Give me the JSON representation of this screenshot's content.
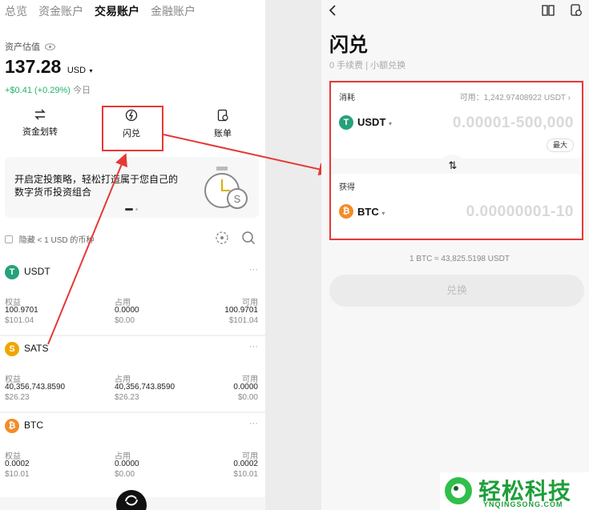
{
  "left": {
    "tabs": [
      "总览",
      "资金账户",
      "交易账户",
      "金融账户"
    ],
    "asset_label": "资产估值",
    "asset_value": "137.28",
    "asset_currency": "USD",
    "change": "+$0.41 (+0.29%)",
    "change_period": "今日",
    "actions": [
      "资金划转",
      "闪兑",
      "账单"
    ],
    "banner_text_1": "开启定投策略，轻松打造属于您自己的",
    "banner_text_2": "数字货币投资组合",
    "hide_small": "隐藏 < 1 USD 的币种",
    "col_labels": [
      "权益",
      "占用",
      "可用"
    ],
    "coins": [
      {
        "name": "USDT",
        "symbol": "T",
        "color": "#26a17b",
        "equity": "100.9701",
        "equity_usd": "$101.04",
        "used": "0.0000",
        "used_usd": "$0.00",
        "avail": "100.9701",
        "avail_usd": "$101.04"
      },
      {
        "name": "SATS",
        "symbol": "S",
        "color": "#f0a500",
        "equity": "40,356,743.8590",
        "equity_usd": "$26.23",
        "used": "40,356,743.8590",
        "used_usd": "$26.23",
        "avail": "0.0000",
        "avail_usd": "$0.00"
      },
      {
        "name": "BTC",
        "symbol": "₿",
        "color": "#f28c28",
        "equity": "0.0002",
        "equity_usd": "$10.01",
        "used": "0.0000",
        "used_usd": "$0.00",
        "avail": "0.0002",
        "avail_usd": "$10.01"
      }
    ],
    "more": "···"
  },
  "right": {
    "title": "闪兑",
    "subtitle": "0 手续费 | 小额兑换",
    "consume_label": "消耗",
    "available": "可用：1,242.97408922 USDT",
    "from_coin": "USDT",
    "from_placeholder": "0.00001-500,000",
    "max_label": "最大",
    "receive_label": "获得",
    "to_coin": "BTC",
    "to_placeholder": "0.00000001-10",
    "rate": "1 BTC ≈ 43,825.5198 USDT",
    "exchange_button": "兑换"
  },
  "watermark": {
    "brand": "轻松科技",
    "url": "YNQINGSONG.COM"
  },
  "colors": {
    "accent_red": "#e53935",
    "green": "#21b36b",
    "usdt": "#26a17b",
    "btc": "#f28c28"
  }
}
